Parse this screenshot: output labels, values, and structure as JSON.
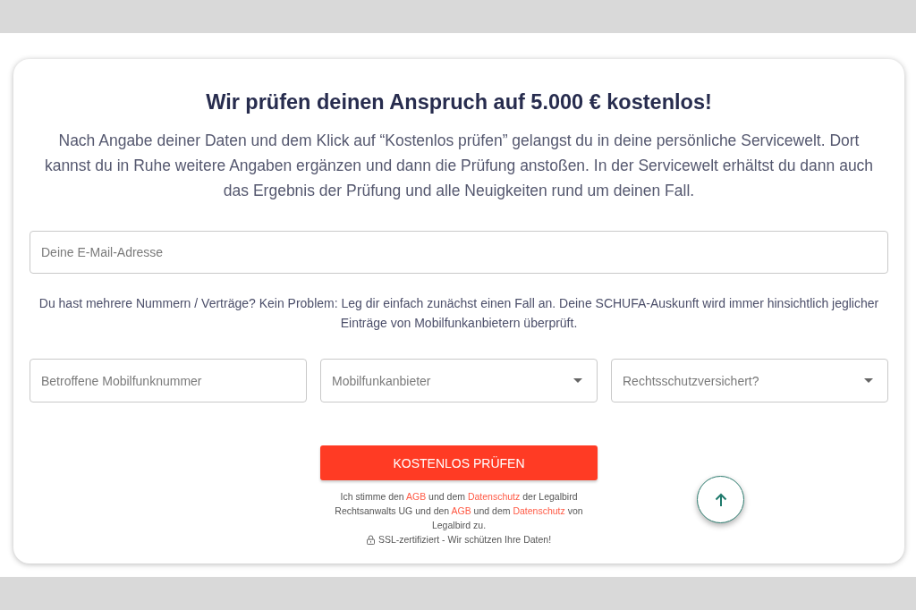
{
  "title": "Wir prüfen deinen Anspruch auf 5.000 € kostenlos!",
  "intro": "Nach Angabe deiner Daten und dem Klick auf “Kostenlos prüfen” gelangst du in deine persönliche Servicewelt. Dort kannst du in Ruhe weitere Angaben ergänzen und dann die Prüfung anstoßen. In der Servicewelt erhältst du dann auch das Ergebnis der Prüfung und alle Neuigkeiten rund um deinen Fall.",
  "email_field": {
    "placeholder": "Deine E-Mail-Adresse"
  },
  "note": "Du hast mehrere Nummern / Verträge? Kein Problem: Leg dir einfach zunächst einen Fall an. Deine SCHUFA-Auskunft wird immer hinsichtlich jeglicher Einträge von Mobilfunkanbietern überprüft.",
  "fields": [
    {
      "kind": "input",
      "placeholder": "Betroffene Mobilfunknummer"
    },
    {
      "kind": "dropdown",
      "placeholder": "Mobilfunkanbieter"
    },
    {
      "kind": "dropdown",
      "placeholder": "Rechtsschutzversichert?"
    }
  ],
  "submit_button": {
    "label": "KOSTENLOS PRÜFEN"
  },
  "consent": [
    {
      "kind": "text",
      "text": "Ich stimme den "
    },
    {
      "kind": "link",
      "text": "AGB"
    },
    {
      "kind": "text",
      "text": " und dem "
    },
    {
      "kind": "link",
      "text": "Datenschutz"
    },
    {
      "kind": "text",
      "text": " der Legalbird Rechtsanwalts UG und den "
    },
    {
      "kind": "link",
      "text": "AGB"
    },
    {
      "kind": "text",
      "text": " und dem "
    },
    {
      "kind": "link",
      "text": "Datenschutz"
    },
    {
      "kind": "text",
      "text": " von Legalbird zu."
    }
  ],
  "ssl_note": "SSL-zertifiziert - Wir schützen Ihre Daten!"
}
